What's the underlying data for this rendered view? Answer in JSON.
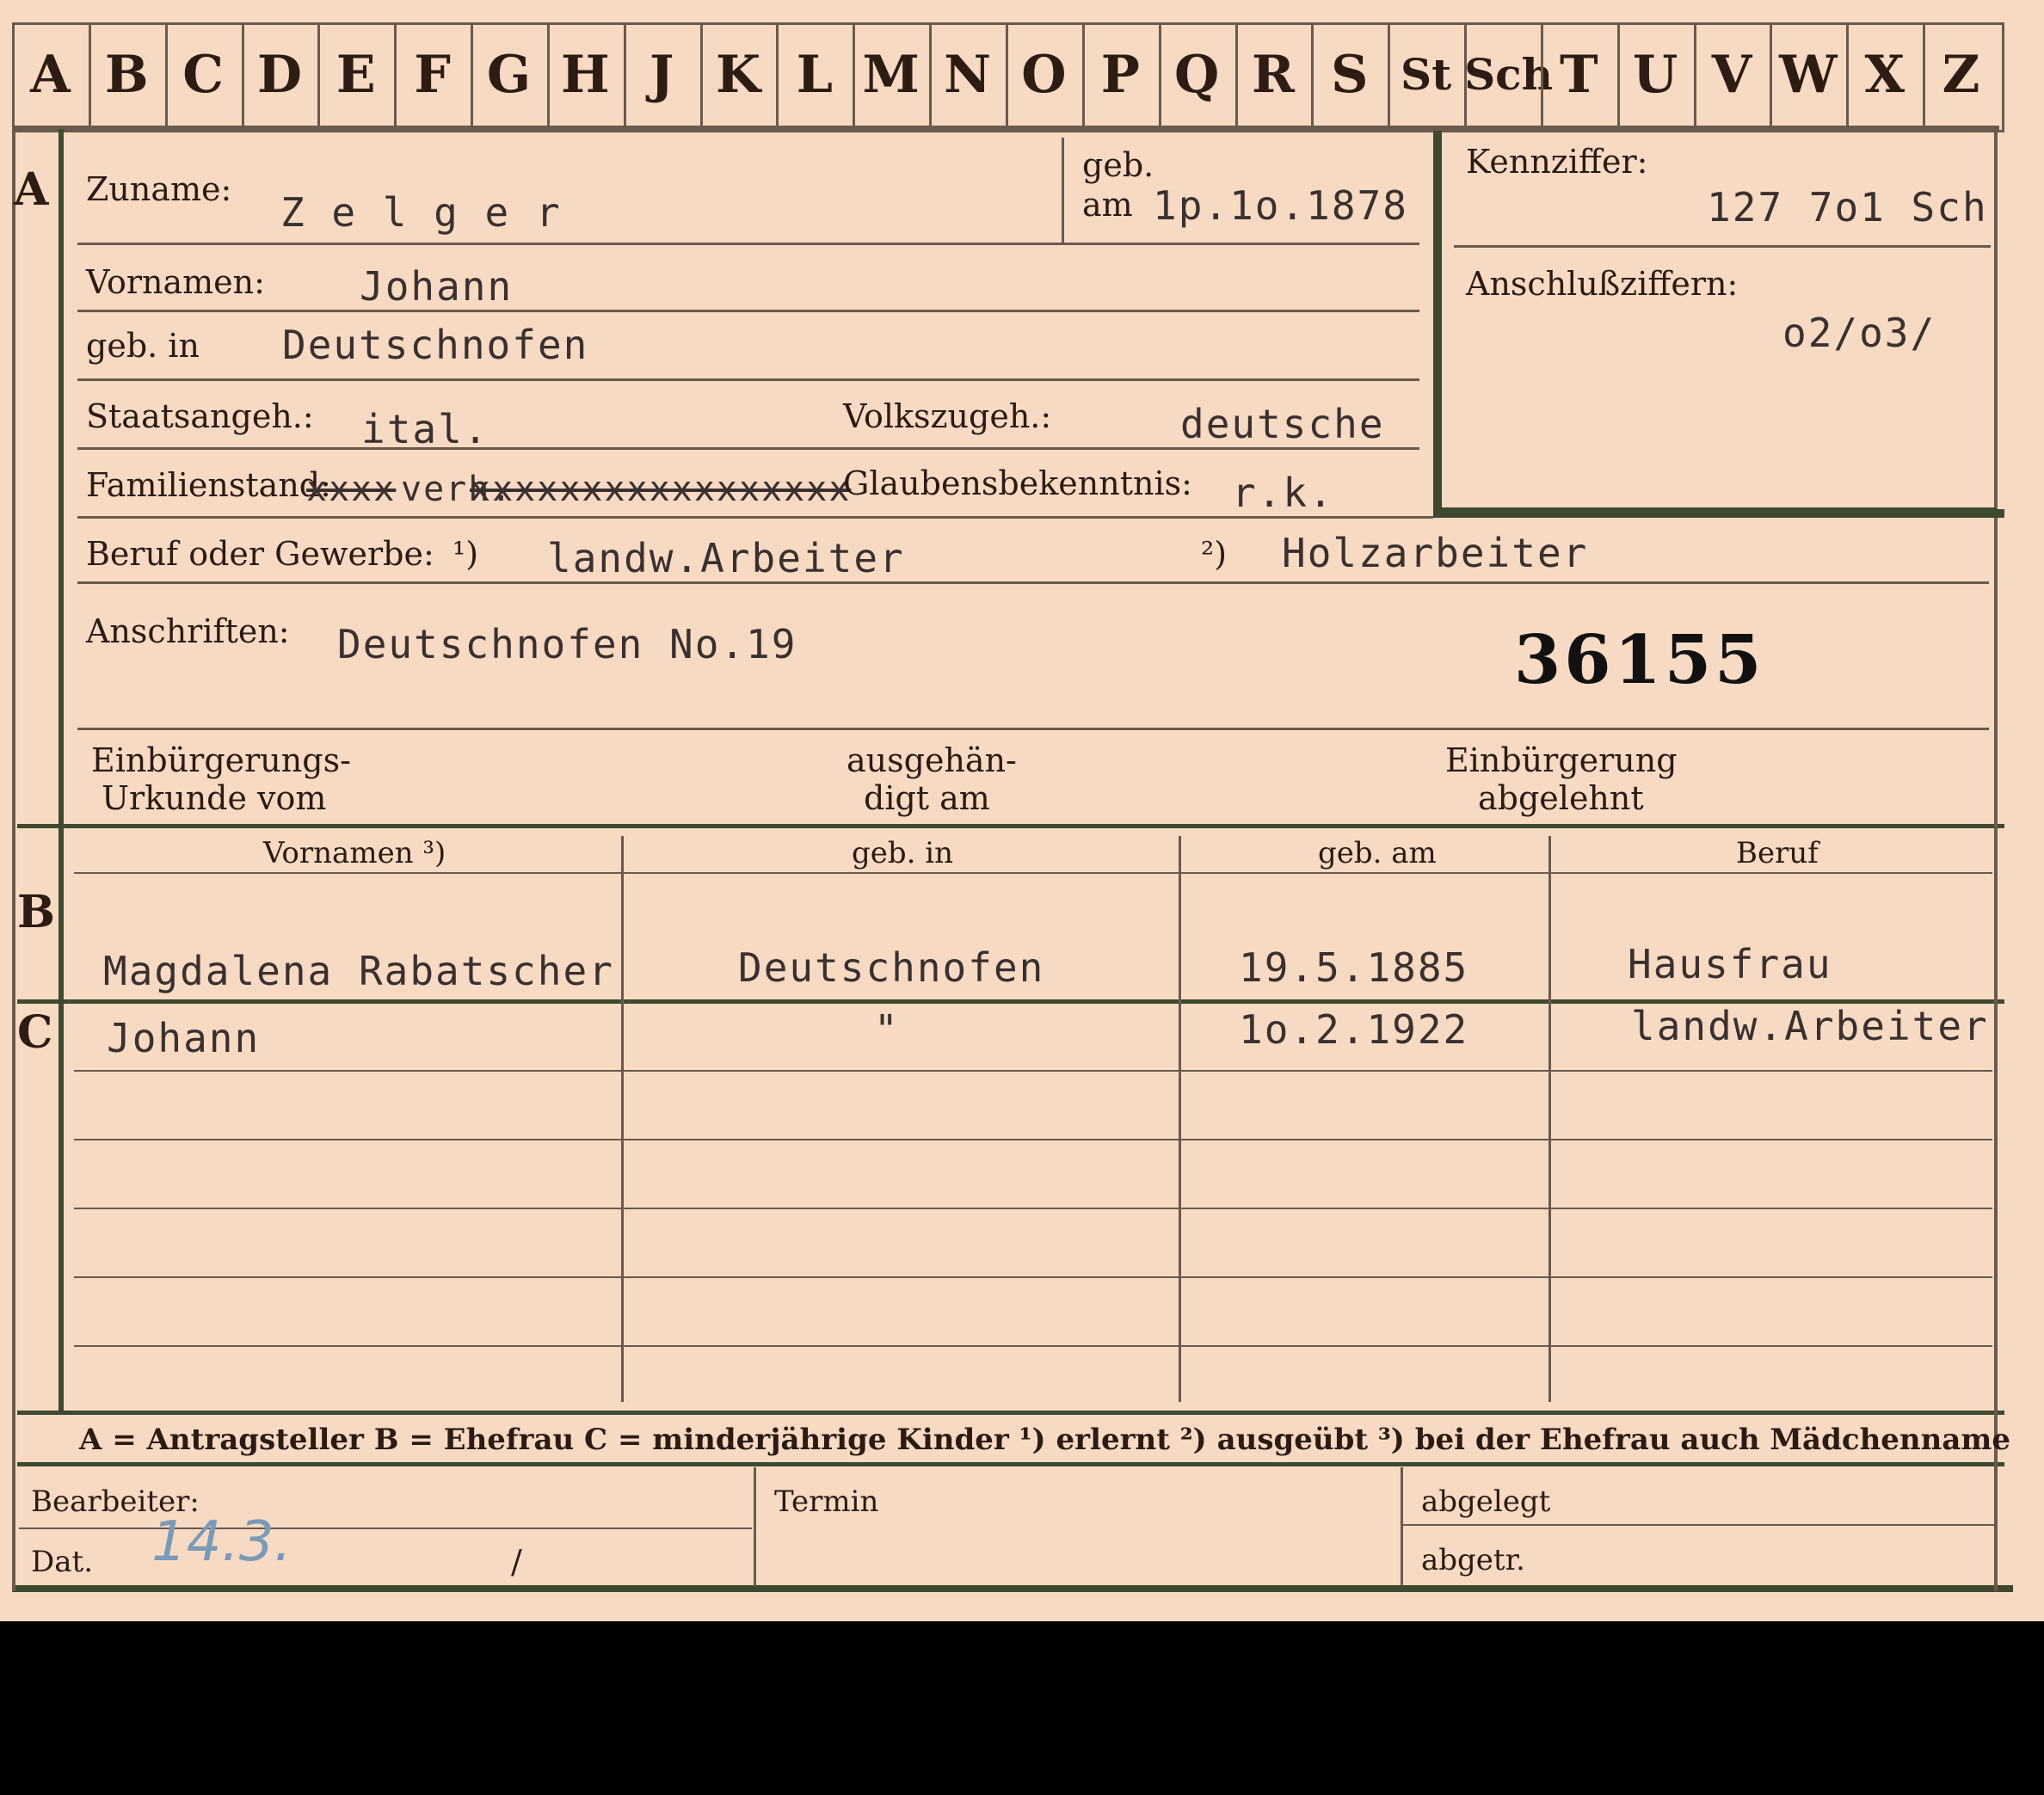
{
  "alphabet": [
    "A",
    "B",
    "C",
    "D",
    "E",
    "F",
    "G",
    "H",
    "J",
    "K",
    "L",
    "M",
    "N",
    "O",
    "P",
    "Q",
    "R",
    "S",
    "St",
    "Sch",
    "T",
    "U",
    "V",
    "W",
    "X",
    "Z"
  ],
  "sections": {
    "a": "A",
    "b": "B",
    "c": "C"
  },
  "labels": {
    "zuname": "Zuname:",
    "geb": "geb.",
    "am": "am",
    "kennziffer": "Kennziffer:",
    "vornamen": "Vornamen:",
    "anschluss": "Anschlußziffern:",
    "geb_in": "geb. in",
    "staatsangeh": "Staatsangeh.:",
    "volkszugeh": "Volkszugeh.:",
    "familienstand": "Familienstand:",
    "glauben": "Glaubensbekenntnis:",
    "beruf": "Beruf oder Gewerbe:",
    "fn1": "¹)",
    "fn2": "²)",
    "anschriften": "Anschriften:",
    "einb1": "Einbürgerungs-",
    "einb2": "Urkunde vom",
    "ausg1": "ausgehän-",
    "ausg2": "digt am",
    "abgl1": "Einbürgerung",
    "abgl2": "abgelehnt",
    "col_vornamen": "Vornamen ³)",
    "col_geb_in": "geb. in",
    "col_geb_am": "geb. am",
    "col_beruf": "Beruf",
    "legend": "A = Antragsteller   B = Ehefrau   C = minderjährige Kinder   ¹) erlernt   ²) ausgeübt   ³) bei der Ehefrau auch Mädchenname",
    "bearbeiter": "Bearbeiter:",
    "dat": "Dat.",
    "termin": "Termin",
    "abgelegt": "abgelegt",
    "abgetr": "abgetr."
  },
  "values": {
    "zuname": "Z e l g e r",
    "geb_am": "1p.1o.1878",
    "kennziffer": "127 7o1 Sch",
    "vornamen": "Johann",
    "anschluss": "o2/o3/",
    "geb_in": "Deutschnofen",
    "staatsangeh": "ital.",
    "volkszugeh": "deutsche",
    "familienstand_struck1": "xxxx",
    "familienstand": "verh.",
    "familienstand_struck2": "xxxxxxxxxxxxxxxxx",
    "glauben": "r.k.",
    "beruf1": "landw.Arbeiter",
    "beruf2": "Holzarbeiter",
    "anschriften": "Deutschnofen No.19",
    "number_stamp": "36155",
    "dat": "14.3.",
    "dat_sep": "/"
  },
  "ehefrau": {
    "vornamen": "Magdalena Rabatscher",
    "geb_in": "Deutschnofen",
    "geb_am": "19.5.1885",
    "beruf": "Hausfrau"
  },
  "kinder": [
    {
      "vornamen": "Johann",
      "geb_in": "\"",
      "geb_am": "1o.2.1922",
      "beruf": "landw.Arbeiter"
    }
  ]
}
